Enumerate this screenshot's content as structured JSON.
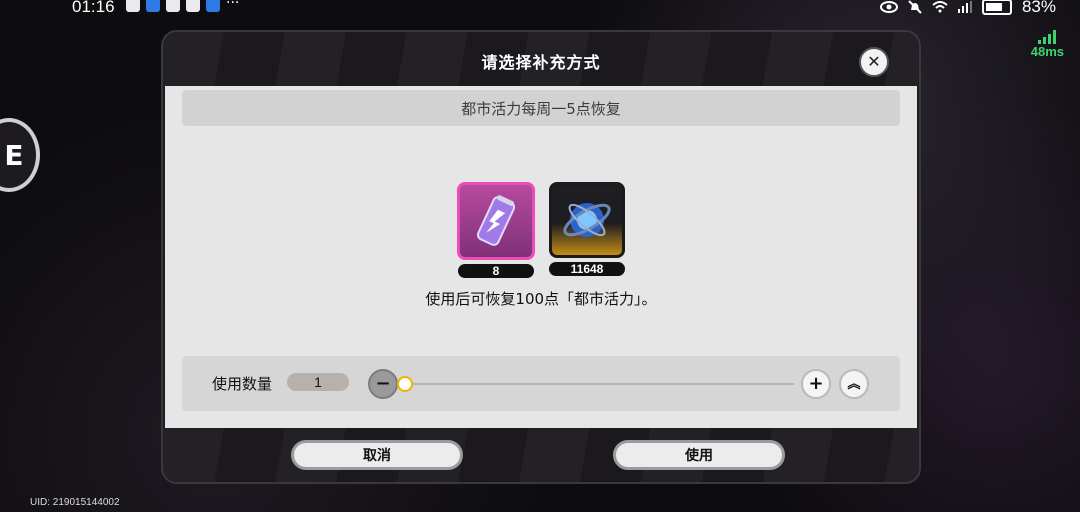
{
  "status_bar": {
    "time": "01:16",
    "battery": "83%",
    "more": "···",
    "ping": "48ms"
  },
  "dialog": {
    "title": "请选择补充方式",
    "close": "✕",
    "notice": "都市活力每周一5点恢复",
    "items": [
      {
        "icon": "energy-drink-icon",
        "count": "8"
      },
      {
        "icon": "blue-orb-icon",
        "count": "11648"
      }
    ],
    "info_text": "使用后可恢复100点「都市活力」。",
    "quantity": {
      "label": "使用数量",
      "value": "1",
      "minus": "−",
      "plus": "+",
      "max": "︽"
    },
    "buttons": {
      "cancel": "取消",
      "use": "使用"
    }
  },
  "side_button": {
    "label": "E"
  },
  "uid": "UID: 219015144002",
  "colors": {
    "accent_pink": "#ef4bb6",
    "accent_gold": "#c48d16",
    "ping_green": "#3fd36b",
    "slider_thumb": "#f0b400"
  }
}
